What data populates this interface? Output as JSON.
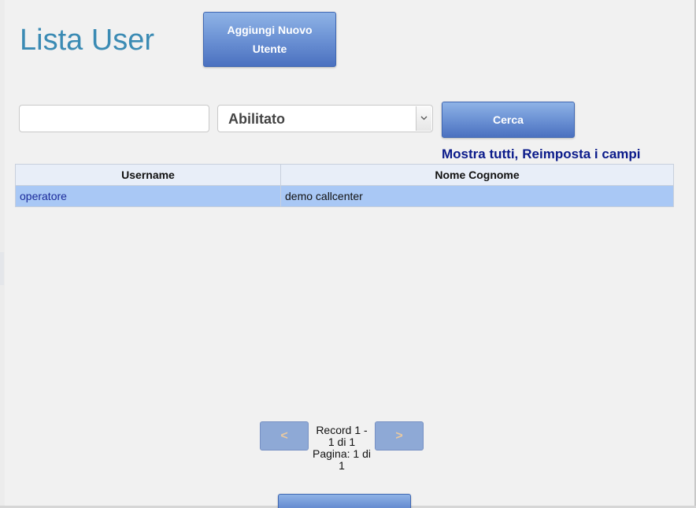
{
  "page": {
    "title": "Lista User"
  },
  "toolbar": {
    "add_button_line1": "Aggiungi Nuovo",
    "add_button_line2": "Utente",
    "search_button_label": "Cerca"
  },
  "filters": {
    "search_value": "",
    "search_placeholder": "",
    "status_selected": "Abilitato"
  },
  "links": {
    "show_all": "Mostra tutti,",
    "reset": "Reimposta i campi"
  },
  "table": {
    "headers": [
      "Username",
      "Nome Cognome"
    ],
    "rows": [
      {
        "username": "operatore",
        "full_name": "demo callcenter"
      }
    ]
  },
  "pagination": {
    "prev_label": "<",
    "next_label": ">",
    "record_line1": "Record 1 -",
    "record_line2": "1 di 1",
    "page_line1": "Pagina: 1 di",
    "page_line2": "1"
  },
  "colors": {
    "title": "#3b8bb4",
    "button_blue": "#6f95d6",
    "row_selected": "#a9c8f5",
    "link": "#0a1a8a"
  }
}
